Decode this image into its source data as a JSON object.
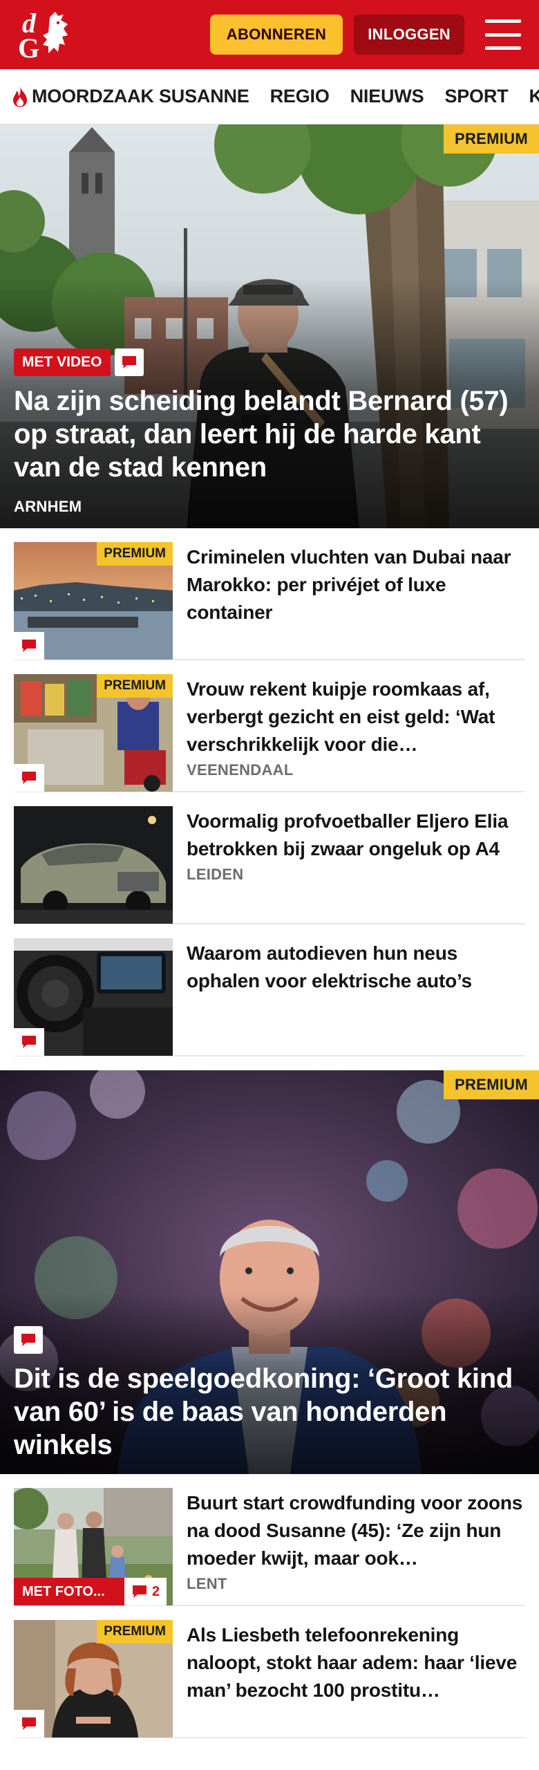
{
  "header": {
    "logo_text": "dG",
    "subscribe_label": "ABONNEREN",
    "login_label": "INLOGGEN",
    "colors": {
      "brand": "#d2111c",
      "subscribe": "#fbc02d",
      "login": "#9e0b12"
    }
  },
  "nav": {
    "items": [
      {
        "label": "MOORDZAAK SUSANNE",
        "icon": "flame-icon"
      },
      {
        "label": "REGIO"
      },
      {
        "label": "NIEUWS"
      },
      {
        "label": "SPORT"
      },
      {
        "label": "KIJK"
      }
    ]
  },
  "hero": {
    "premium": "PREMIUM",
    "video_badge": "MET VIDEO",
    "title": "Na zijn scheiding belandt Bernard (57) op straat, dan leert hij de harde kant van de stad kennen",
    "location": "ARNHEM"
  },
  "list1": [
    {
      "premium": "PREMIUM",
      "title": "Criminelen vluchten van Dubai naar Marokko: per privéjet of luxe container",
      "location": ""
    },
    {
      "premium": "PREMIUM",
      "title": "Vrouw rekent kuipje roomkaas af, verbergt gezicht en eist geld: ‘Wat verschrikkelijk voor die…",
      "location": "VEENENDAAL"
    },
    {
      "premium": "",
      "title": "Voormalig profvoetballer Eljero Elia betrokken bij zwaar ongeluk op A4",
      "location": "LEIDEN"
    },
    {
      "premium": "",
      "title": "Waarom autodieven hun neus ophalen voor elektrische auto’s",
      "location": ""
    }
  ],
  "feature": {
    "premium": "PREMIUM",
    "title": "Dit is de speelgoedkoning: ‘Groot kind van 60’ is de baas van honderden winkels"
  },
  "list2": [
    {
      "photo_badge": "MET FOTO...",
      "comments": "2",
      "title": "Buurt start crowdfunding voor zoons na dood Susanne (45): ‘Ze zijn hun moeder kwijt, maar ook…",
      "location": "LENT"
    },
    {
      "premium": "PREMIUM",
      "title": "Als Liesbeth telefoonrekening naloopt, stokt haar adem: haar ‘lieve man’ bezocht 100 prostitu…",
      "location": ""
    }
  ]
}
